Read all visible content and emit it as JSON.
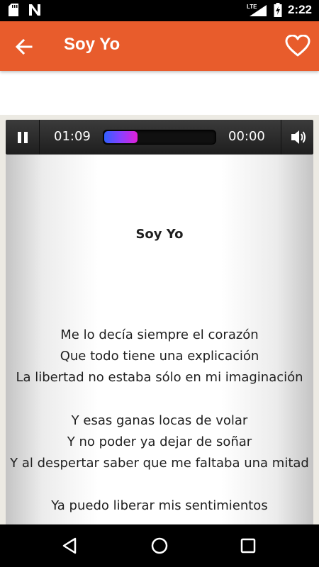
{
  "status_bar": {
    "time": "2:22",
    "network": "LTE",
    "icons": [
      "sd-card-icon",
      "n-notification-icon",
      "signal-icon",
      "battery-icon"
    ]
  },
  "app_bar": {
    "title": "Soy Yo",
    "background_color": "#e85c2c",
    "back_icon": "arrow-left-icon",
    "favorite_icon": "heart-outline-icon"
  },
  "player": {
    "current_time": "01:09",
    "total_time": "00:00",
    "progress_fraction": 0.3,
    "pause_icon": "pause-icon",
    "volume_icon": "volume-icon"
  },
  "lyrics": {
    "title": "Soy Yo",
    "stanzas": [
      [
        "Me lo decía siempre el corazón",
        "Que todo tiene una explicación",
        "La libertad no estaba sólo en mi imaginación"
      ],
      [
        "Y esas ganas locas de volar",
        "Y no poder ya dejar de soñar",
        "Y al despertar saber que me faltaba una mitad"
      ],
      [
        "Ya puedo liberar mis sentimientos"
      ]
    ]
  },
  "nav_bar": {
    "icons": [
      "back-triangle-icon",
      "home-circle-icon",
      "recents-square-icon"
    ]
  }
}
